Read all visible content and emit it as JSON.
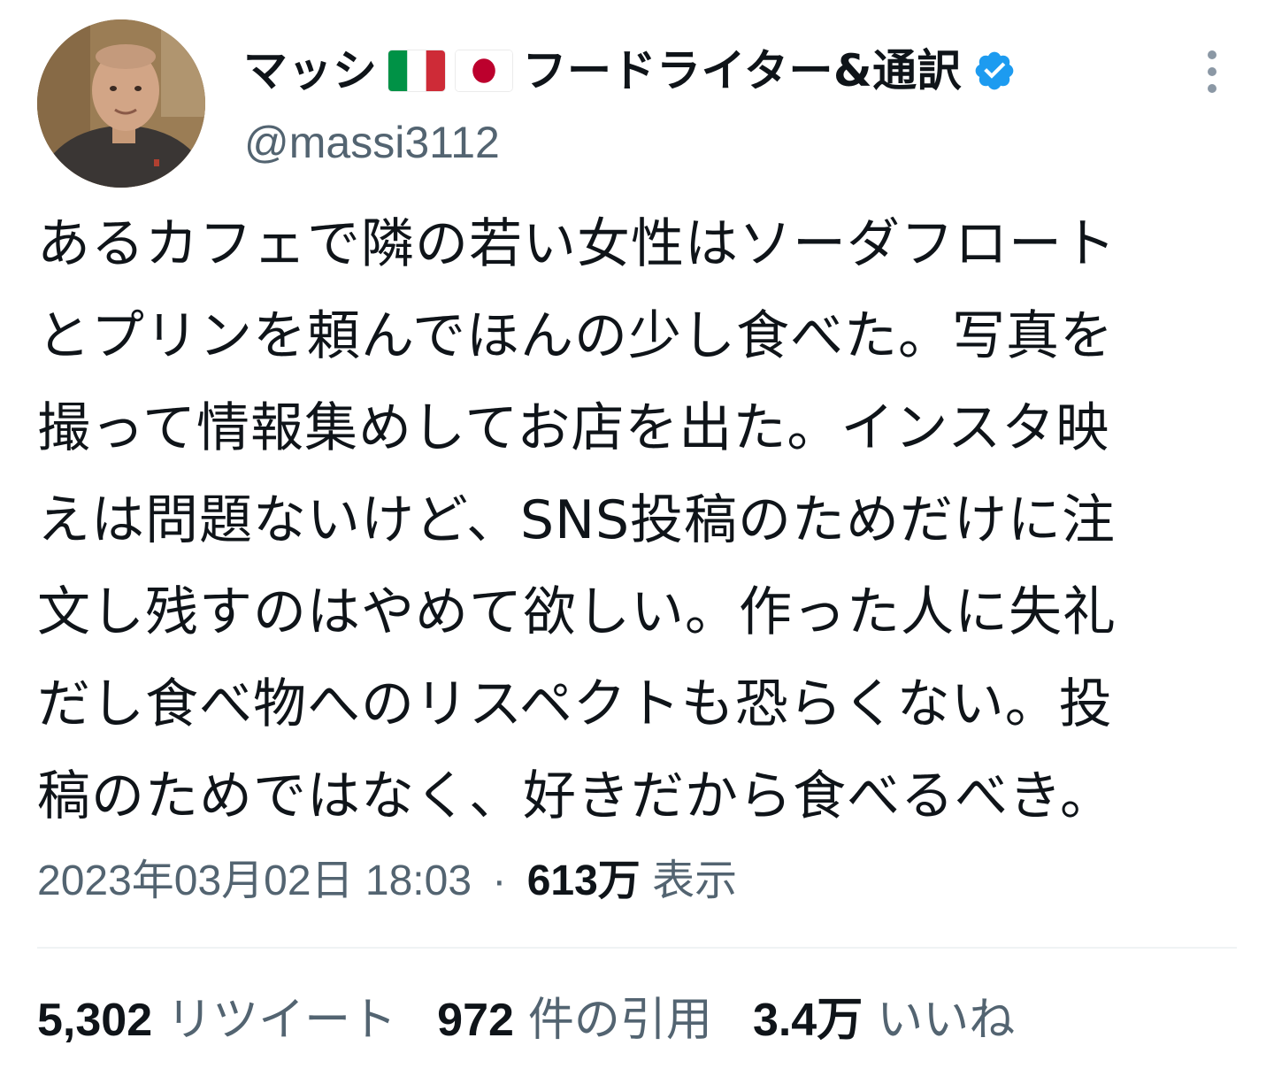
{
  "user": {
    "display_name": "マッシ",
    "display_name_suffix": "フードライター&通訳",
    "flags": [
      "flag-italy",
      "flag-japan"
    ],
    "handle": "@massi3112",
    "verified": true,
    "verified_color": "#1d9bf0"
  },
  "tweet": {
    "lines": [
      "あるカフェで隣の若い女性はソーダフロート",
      "とプリンを頼んでほんの少し食べた。写真を",
      "撮って情報集めしてお店を出た。インスタ映",
      "えは問題ないけど、SNS投稿のためだけに注",
      "文し残すのはやめて欲しい。作った人に失礼",
      "だし食べ物へのリスペクトも恐らくない。投",
      "稿のためではなく、好きだから食べるべき。"
    ],
    "timestamp": "2023年03月02日 18:03",
    "separator": "·",
    "views_count": "613万",
    "views_label": "表示"
  },
  "stats": {
    "retweets_count": "5,302",
    "retweets_label": "リツイート",
    "quotes_count": "972",
    "quotes_label": "件の引用",
    "likes_count": "3.4万",
    "likes_label": "いいね"
  },
  "icons": {
    "more": "more-vertical-icon",
    "verified": "verified-badge-icon"
  },
  "colors": {
    "text_primary": "#0f1419",
    "text_secondary": "#536471",
    "divider": "#eff3f4"
  }
}
